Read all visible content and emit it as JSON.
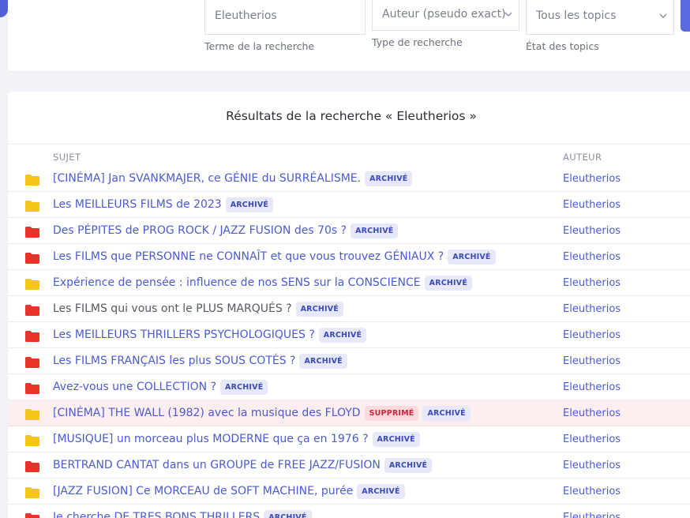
{
  "search": {
    "term_value": "Eleutherios",
    "term_help": "Terme de la recherche",
    "type_value": "Auteur (pseudo exact)",
    "type_help": "Type de recherche",
    "state_value": "Tous les topics",
    "state_help": "État des topics"
  },
  "results": {
    "title": "Résultats de la recherche « Eleutherios »",
    "columns": {
      "subject": "SUJET",
      "author": "AUTEUR"
    },
    "rows": [
      {
        "subject": "[CINÉMA] Jan SVANKMAJER, ce GÉNIE du SURRÉALISME.",
        "badges": [
          "ARCHIVÉ"
        ],
        "author": "Eleutherios",
        "folder": "yellow"
      },
      {
        "subject": "Les MEILLEURS FILMS de 2023",
        "badges": [
          "ARCHIVÉ"
        ],
        "author": "Eleutherios",
        "folder": "yellow"
      },
      {
        "subject": "Des PÉPITES de PROG ROCK / JAZZ FUSION des 70s ?",
        "badges": [
          "ARCHIVÉ"
        ],
        "author": "Eleutherios",
        "folder": "red"
      },
      {
        "subject": "Les FILMS que PERSONNE ne CONNAÎT et que vous trouvez GÉNIAUX ?",
        "badges": [
          "ARCHIVÉ"
        ],
        "author": "Eleutherios",
        "folder": "red"
      },
      {
        "subject": "Expérience de pensée : influence de nos SENS sur la CONSCIENCE",
        "badges": [
          "ARCHIVÉ"
        ],
        "author": "Eleutherios",
        "folder": "yellow"
      },
      {
        "subject": "Les FILMS qui vous ont le PLUS MARQUÉS ?",
        "badges": [
          "ARCHIVÉ"
        ],
        "author": "Eleutherios",
        "folder": "red",
        "visited": true
      },
      {
        "subject": "Les MEILLEURS THRILLERS PSYCHOLOGIQUES ?",
        "badges": [
          "ARCHIVÉ"
        ],
        "author": "Eleutherios",
        "folder": "red"
      },
      {
        "subject": "Les FILMS FRANÇAIS les plus SOUS COTÉS ?",
        "badges": [
          "ARCHIVÉ"
        ],
        "author": "Eleutherios",
        "folder": "red"
      },
      {
        "subject": "Avez-vous une COLLECTION ?",
        "badges": [
          "ARCHIVÉ"
        ],
        "author": "Eleutherios",
        "folder": "red"
      },
      {
        "subject": "[CINÉMA] THE WALL (1982) avec la musique des FLOYD",
        "badges": [
          "SUPPRIMÉ",
          "ARCHIVÉ"
        ],
        "author": "Eleutherios",
        "folder": "yellow",
        "deleted": true
      },
      {
        "subject": "[MUSIQUE] un morceau plus MODERNE que ça en 1976 ?",
        "badges": [
          "ARCHIVÉ"
        ],
        "author": "Eleutherios",
        "folder": "yellow"
      },
      {
        "subject": "BERTRAND CANTAT dans un GROUPE de FREE JAZZ/FUSION",
        "badges": [
          "ARCHIVÉ"
        ],
        "author": "Eleutherios",
        "folder": "red"
      },
      {
        "subject": "[JAZZ FUSION] Ce MORCEAU de SOFT MACHINE, purée",
        "badges": [
          "ARCHIVÉ"
        ],
        "author": "Eleutherios",
        "folder": "yellow"
      },
      {
        "subject": "Je cherche DE TRES BONS THRILLERS",
        "badges": [
          "ARCHIVÉ"
        ],
        "author": "Eleutherios",
        "folder": "red"
      }
    ]
  },
  "colors": {
    "link": "#4a5bd4",
    "folder_yellow": "#f5c518",
    "folder_red": "#e8332a",
    "badge_archive_bg": "#e7e9fb",
    "badge_deleted_bg": "#fbdade"
  },
  "icons": {
    "folder": "folder-icon",
    "caret": "chevron-down-icon"
  }
}
